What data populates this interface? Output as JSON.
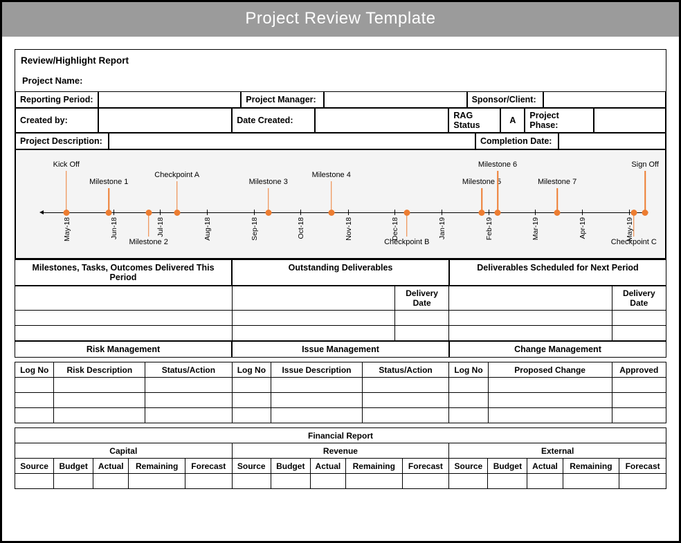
{
  "title": "Project Review Template",
  "report_title": "Review/Highlight Report",
  "labels": {
    "project_name": "Project Name:",
    "reporting_period": "Reporting Period:",
    "project_manager": "Project Manager:",
    "sponsor_client": "Sponsor/Client:",
    "created_by": "Created by:",
    "date_created": "Date Created:",
    "rag_status": "RAG Status",
    "project_phase": "Project Phase:",
    "project_description": "Project Description:",
    "completion_date": "Completion Date:"
  },
  "rag_value": "A",
  "deliverables": {
    "this_period": "Milestones, Tasks, Outcomes Delivered This Period",
    "outstanding": "Outstanding Deliverables",
    "next_period": "Deliverables Scheduled for Next Period",
    "delivery_date": "Delivery Date"
  },
  "mgmt": {
    "risk": "Risk Management",
    "issue": "Issue Management",
    "change": "Change Management",
    "log_no": "Log No",
    "risk_desc": "Risk Description",
    "status_action": "Status/Action",
    "issue_desc": "Issue Description",
    "proposed_change": "Proposed Change",
    "approved": "Approved"
  },
  "fin": {
    "header": "Financial Report",
    "capital": "Capital",
    "revenue": "Revenue",
    "external": "External",
    "source": "Source",
    "budget": "Budget",
    "actual": "Actual",
    "remaining": "Remaining",
    "forecast": "Forecast"
  },
  "chart_data": {
    "type": "timeline",
    "axis_ticks": [
      {
        "label": "May-18",
        "pos": 0.04
      },
      {
        "label": "Jun-18",
        "pos": 0.123
      },
      {
        "label": "Jul-18",
        "pos": 0.205
      },
      {
        "label": "Aug-18",
        "pos": 0.288
      },
      {
        "label": "Sep-18",
        "pos": 0.371
      },
      {
        "label": "Oct-18",
        "pos": 0.453
      },
      {
        "label": "Nov-18",
        "pos": 0.536
      },
      {
        "label": "Dec-18",
        "pos": 0.618
      },
      {
        "label": "Jan-19",
        "pos": 0.701
      },
      {
        "label": "Feb-19",
        "pos": 0.784
      },
      {
        "label": "Mar-19",
        "pos": 0.866
      },
      {
        "label": "Apr-19",
        "pos": 0.949
      },
      {
        "label": "May-19",
        "pos": 1.032
      }
    ],
    "milestones": [
      {
        "label": "Kick Off",
        "pos": 0.04,
        "dir": "up",
        "stick": 60
      },
      {
        "label": "Milestone 1",
        "pos": 0.115,
        "dir": "up",
        "stick": 35
      },
      {
        "label": "Milestone 2",
        "pos": 0.185,
        "dir": "down",
        "stick": 35
      },
      {
        "label": "Checkpoint A",
        "pos": 0.235,
        "dir": "up",
        "stick": 45
      },
      {
        "label": "Milestone 3",
        "pos": 0.396,
        "dir": "up",
        "stick": 35
      },
      {
        "label": "Milestone 4",
        "pos": 0.507,
        "dir": "up",
        "stick": 45
      },
      {
        "label": "Checkpoint B",
        "pos": 0.64,
        "dir": "down",
        "stick": 35
      },
      {
        "label": "Milestone 5",
        "pos": 0.772,
        "dir": "up",
        "stick": 35
      },
      {
        "label": "Milestone 6",
        "pos": 0.8,
        "dir": "up",
        "stick": 60
      },
      {
        "label": "Milestone 7",
        "pos": 0.905,
        "dir": "up",
        "stick": 35
      },
      {
        "label": "Checkpoint C",
        "pos": 1.04,
        "dir": "down",
        "stick": 35
      },
      {
        "label": "Sign Off",
        "pos": 1.06,
        "dir": "up",
        "stick": 60
      }
    ]
  }
}
